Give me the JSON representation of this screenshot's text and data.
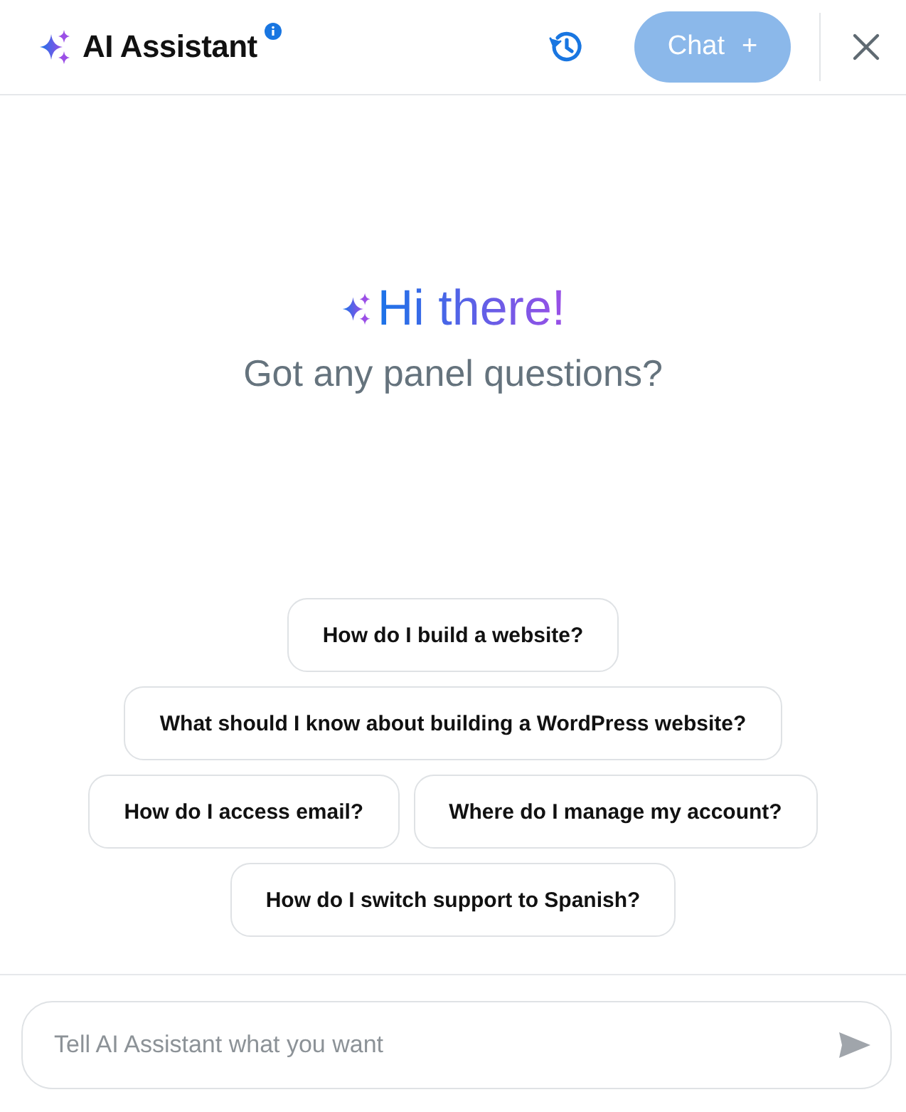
{
  "header": {
    "title": "AI Assistant",
    "new_chat_button": {
      "label": "Chat",
      "icon": "+",
      "disabled": true
    }
  },
  "greeting": {
    "headline": "Hi there!",
    "subtitle": "Got any panel questions?"
  },
  "suggestions": [
    {
      "label": "How do I build a website?"
    },
    {
      "label": "What should I know about building a WordPress website?"
    },
    {
      "label": "How do I access email?"
    },
    {
      "label": "Where do I manage my account?"
    },
    {
      "label": "How do I switch support to Spanish?"
    }
  ],
  "composer": {
    "placeholder": "Tell AI Assistant what you want"
  }
}
